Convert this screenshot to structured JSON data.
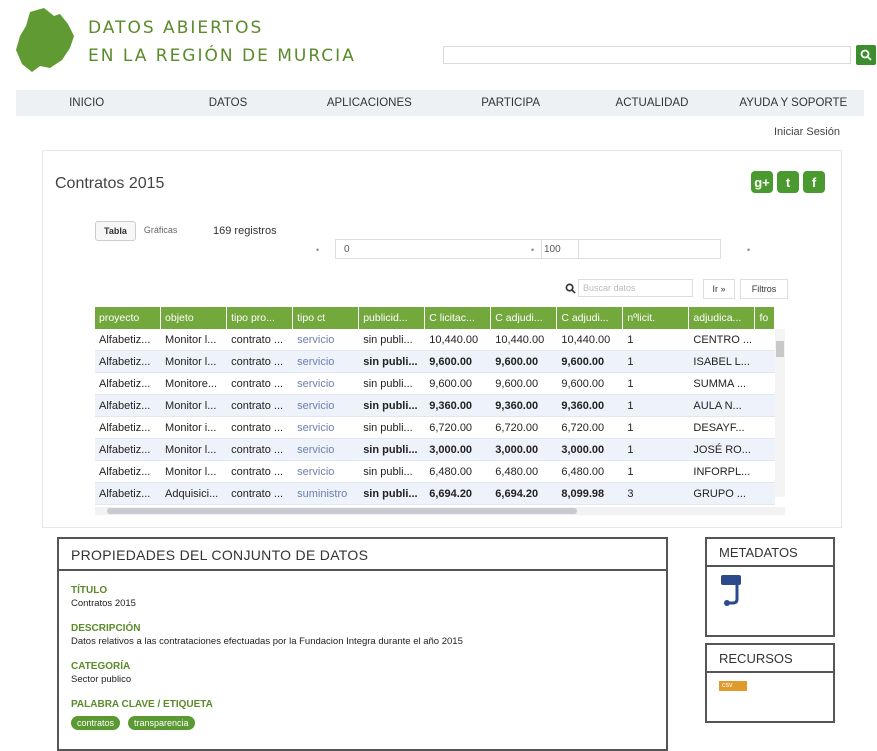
{
  "site": {
    "title_line1": "DATOS ABIERTOS",
    "title_line2": "EN LA REGIÓN DE MURCIA"
  },
  "colors": {
    "brand_green": "#5a8a2a",
    "header_row": "#73a83d",
    "link": "#6c7fae"
  },
  "nav": [
    {
      "label": "INICIO"
    },
    {
      "label": "DATOS"
    },
    {
      "label": "APLICACIONES"
    },
    {
      "label": "PARTICIPA"
    },
    {
      "label": "ACTUALIDAD"
    },
    {
      "label": "AYUDA Y SOPORTE"
    }
  ],
  "login": "Iniciar Sesión",
  "dataset": {
    "title": "Contratos 2015",
    "tabs": [
      "Tabla",
      "Gráficas"
    ],
    "count": "169 registros",
    "range_from": "0",
    "range_to": "100",
    "search_placeholder": "Buscar datos",
    "go": "Ir »",
    "filters": "Filtros"
  },
  "social": [
    "g+",
    "t",
    "f"
  ],
  "table": {
    "headers": [
      "proyecto",
      "objeto",
      "tipo pro...",
      "tipo ct",
      "publicid...",
      "C licitac...",
      "C adjudi...",
      "C adjudi...",
      "nºlicit.",
      "adjudica...",
      "fo"
    ],
    "rows": [
      [
        "Alfabetiz...",
        "Monitor l...",
        "contrato ...",
        "servicio",
        "sin publi...",
        "10,440.00",
        "10,440.00",
        "10,440.00",
        "1",
        "CENTRO ...",
        ""
      ],
      [
        "Alfabetiz...",
        "Monitor l...",
        "contrato ...",
        "servicio",
        "sin publi...",
        "9,600.00",
        "9,600.00",
        "9,600.00",
        "1",
        "ISABEL L...",
        ""
      ],
      [
        "Alfabetiz...",
        "Monitore...",
        "contrato ...",
        "servicio",
        "sin publi...",
        "9,600.00",
        "9,600.00",
        "9,600.00",
        "1",
        "SUMMA ...",
        ""
      ],
      [
        "Alfabetiz...",
        "Monitor l...",
        "contrato ...",
        "servicio",
        "sin publi...",
        "9,360.00",
        "9,360.00",
        "9,360.00",
        "1",
        "AULA N...",
        ""
      ],
      [
        "Alfabetiz...",
        "Monitor i...",
        "contrato ...",
        "servicio",
        "sin publi...",
        "6,720.00",
        "6,720.00",
        "6,720.00",
        "1",
        "DESAYF...",
        ""
      ],
      [
        "Alfabetiz...",
        "Monitor l...",
        "contrato ...",
        "servicio",
        "sin publi...",
        "3,000.00",
        "3,000.00",
        "3,000.00",
        "1",
        "JOSÉ RO...",
        ""
      ],
      [
        "Alfabetiz...",
        "Monitor l...",
        "contrato ...",
        "servicio",
        "sin publi...",
        "6,480.00",
        "6,480.00",
        "6,480.00",
        "1",
        "INFORPL...",
        ""
      ],
      [
        "Alfabetiz...",
        "Adquisici...",
        "contrato ...",
        "suministro",
        "sin publi...",
        "6,694.20",
        "6,694.20",
        "8,099.98",
        "3",
        "GRUPO ...",
        ""
      ]
    ]
  },
  "properties": {
    "heading": "PROPIEDADES DEL CONJUNTO DE DATOS",
    "title_label": "TÍTULO",
    "title_value": "Contratos 2015",
    "desc_label": "DESCRIPCIÓN",
    "desc_value": "Datos relativos a las contrataciones efectuadas por la Fundacion Integra durante el año 2015",
    "cat_label": "CATEGORÍA",
    "cat_value": "Sector publico",
    "tags_label": "PALABRA CLAVE / ETIQUETA",
    "tags": [
      "contratos",
      "transparencia"
    ]
  },
  "metadatos": {
    "heading": "METADATOS"
  },
  "recursos": {
    "heading": "RECURSOS",
    "badge": "csv"
  }
}
